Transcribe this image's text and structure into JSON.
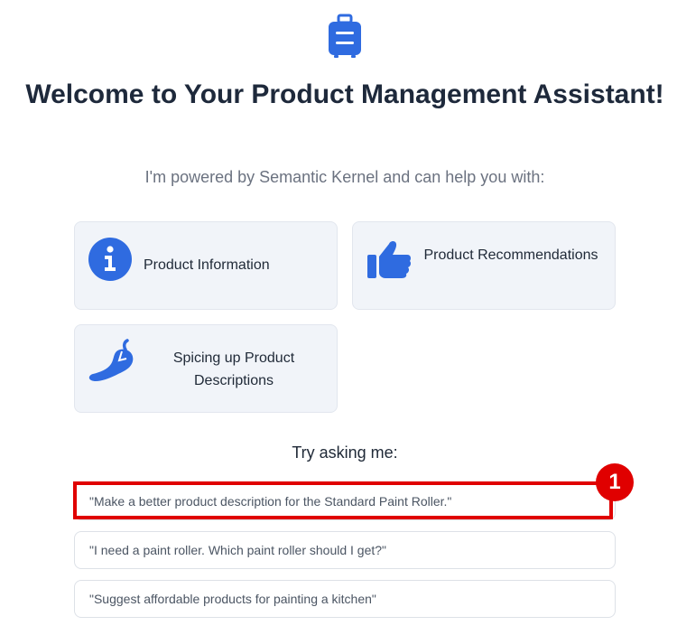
{
  "header": {
    "logo_icon": "suitcase-icon",
    "title": "Welcome to Your Product Management Assistant!",
    "subtitle": "I'm powered by Semantic Kernel and can help you with:"
  },
  "features": [
    {
      "icon": "info-circle-icon",
      "label": "Product Information"
    },
    {
      "icon": "thumbs-up-icon",
      "label": "Product Recommendations"
    },
    {
      "icon": "pepper-icon",
      "label": "Spicing up Product Descriptions"
    }
  ],
  "suggestions": {
    "heading": "Try asking me:",
    "items": [
      "\"Make a better product description for the Standard Paint Roller.\"",
      "\"I need a paint roller. Which paint roller should I get?\"",
      "\"Suggest affordable products for painting a kitchen\""
    ]
  },
  "annotation": {
    "marker_label": "1",
    "color": "#e00000"
  },
  "colors": {
    "accent": "#2f6be0",
    "card_bg": "#f1f4f9",
    "title": "#1e293b",
    "muted": "#6b7280"
  }
}
